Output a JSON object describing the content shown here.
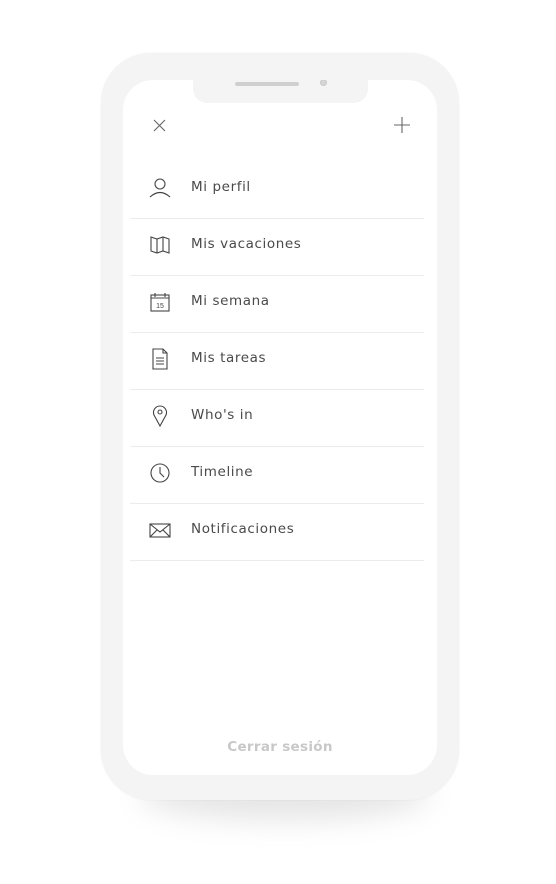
{
  "header": {
    "close_icon": "close-icon",
    "add_icon": "plus-icon"
  },
  "menu": {
    "items": [
      {
        "label": "Mi perfil",
        "icon": "user-icon"
      },
      {
        "label": "Mis vacaciones",
        "icon": "map-icon"
      },
      {
        "label": "Mi semana",
        "icon": "calendar-icon",
        "icon_text": "15"
      },
      {
        "label": "Mis tareas",
        "icon": "document-icon"
      },
      {
        "label": "Who's in",
        "icon": "location-pin-icon"
      },
      {
        "label": "Timeline",
        "icon": "clock-icon"
      },
      {
        "label": "Notificaciones",
        "icon": "envelope-icon"
      }
    ]
  },
  "footer": {
    "logout_label": "Cerrar sesión"
  },
  "colors": {
    "text": "#4a4a4a",
    "logout": "#c8c8c8",
    "frame": "#f4f4f4",
    "divider": "#ececec"
  }
}
